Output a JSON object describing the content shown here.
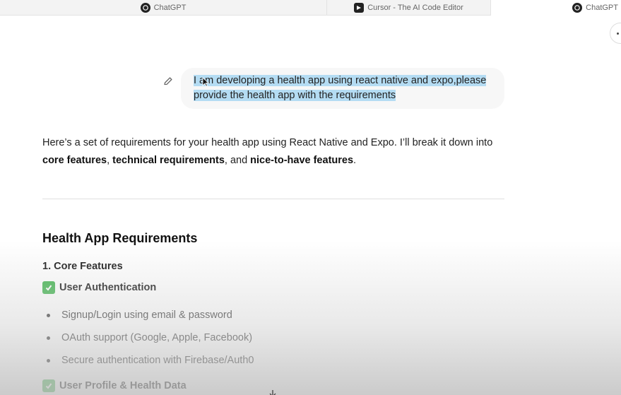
{
  "tabs": [
    {
      "label": "ChatGPT",
      "icon": "chatgpt-icon"
    },
    {
      "label": "Cursor - The AI Code Editor",
      "icon": "cursor-icon"
    },
    {
      "label": "ChatGPT",
      "icon": "chatgpt-icon"
    }
  ],
  "user_message": {
    "text": "I am developing a health app using react native and expo,please provide the health app with the requirements"
  },
  "assistant": {
    "intro_1": "Here’s a set of requirements for your health app using React Native and Expo. I’ll break it down into",
    "intro_b1": "core features",
    "intro_sep1": ", ",
    "intro_b2": "technical requirements",
    "intro_sep2": ", and ",
    "intro_b3": "nice-to-have features",
    "intro_end": ".",
    "heading": "Health App Requirements",
    "section": "1. Core Features",
    "checks": [
      {
        "label": "User Authentication"
      },
      {
        "label": "User Profile & Health Data"
      }
    ],
    "bullets": [
      "Signup/Login using email & password",
      "OAuth support (Google, Apple, Facebook)",
      "Secure authentication with Firebase/Auth0"
    ]
  },
  "colors": {
    "selection": "#b4dcf3",
    "check": "#3db24b"
  }
}
